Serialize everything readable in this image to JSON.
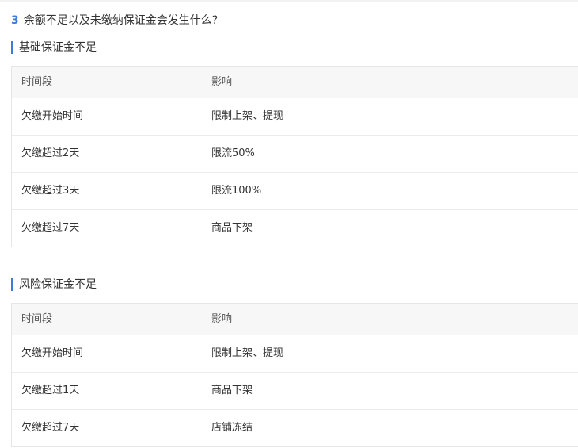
{
  "question": {
    "number": "3",
    "text": "余额不足以及未缴纳保证金会发生什么?"
  },
  "sections": [
    {
      "title": "基础保证金不足",
      "headers": [
        "时间段",
        "影响"
      ],
      "rows": [
        [
          "欠缴开始时间",
          "限制上架、提现"
        ],
        [
          "欠缴超过2天",
          "限流50%"
        ],
        [
          "欠缴超过3天",
          "限流100%"
        ],
        [
          "欠缴超过7天",
          "商品下架"
        ]
      ]
    },
    {
      "title": "风险保证金不足",
      "headers": [
        "时间段",
        "影响"
      ],
      "rows": [
        [
          "欠缴开始时间",
          "限制上架、提现"
        ],
        [
          "欠缴超过1天",
          "商品下架"
        ],
        [
          "欠缴超过7天",
          "店铺冻结"
        ]
      ]
    }
  ],
  "colors": {
    "accent": "#3f7bd8",
    "header_bg": "#f7f7f8",
    "border": "#e6e6e6"
  }
}
